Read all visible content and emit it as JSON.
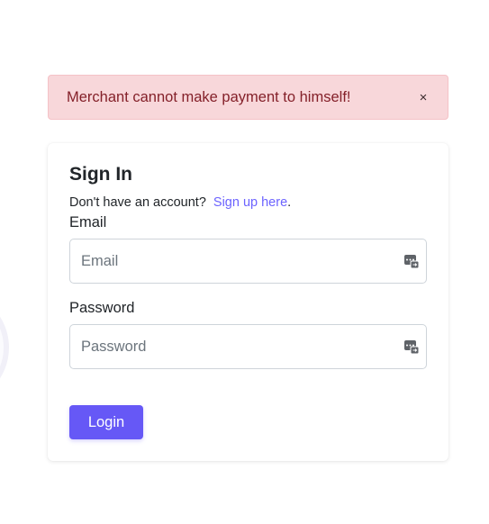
{
  "alert": {
    "message": "Merchant cannot make payment to himself!",
    "close_symbol": "×"
  },
  "signin": {
    "title": "Sign In",
    "no_account_text": "Don't have an account?",
    "signup_link": "Sign up here",
    "signup_suffix": ".",
    "email_label": "Email",
    "email_placeholder": "Email",
    "email_value": "",
    "password_label": "Password",
    "password_placeholder": "Password",
    "password_value": "",
    "login_button": "Login",
    "autofill_icon": "password-manager-icon"
  },
  "colors": {
    "alert_bg": "#f8d7da",
    "alert_text": "#842029",
    "accent": "#6658f6",
    "link": "#6c63ff"
  }
}
